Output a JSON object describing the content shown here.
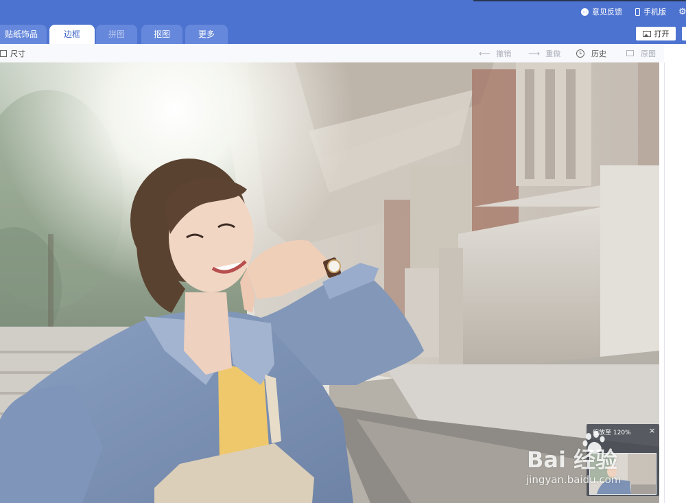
{
  "header": {
    "feedback_label": "意见反馈",
    "mobile_label": "手机版",
    "open_button_label": "打开"
  },
  "tabs": [
    {
      "label": "贴纸饰品",
      "active": false
    },
    {
      "label": "边框",
      "active": true
    },
    {
      "label": "拼图",
      "active": false
    },
    {
      "label": "抠图",
      "active": false
    },
    {
      "label": "更多",
      "active": false
    }
  ],
  "toolbar": {
    "size_label": "尺寸",
    "undo_label": "撤销",
    "redo_label": "重做",
    "history_label": "历史",
    "original_label": "原图"
  },
  "zoom": {
    "label": "缩放至 120%",
    "close_symbol": "×"
  },
  "watermark": {
    "logo_text": "Bai  经验",
    "url_text": "jingyan.baidu.com"
  },
  "icons": {
    "feedback": "chat-bubble-icon",
    "mobile": "phone-icon",
    "settings": "gear-icon",
    "open": "image-icon",
    "size": "crop-square-icon",
    "undo": "arrow-left-icon",
    "redo": "arrow-right-icon",
    "history": "clock-icon",
    "original": "picture-icon"
  },
  "colors": {
    "header_blue": "#4d73d0",
    "active_tab_text": "#3f67c8",
    "toolbar_bg": "#f8f9fc"
  }
}
